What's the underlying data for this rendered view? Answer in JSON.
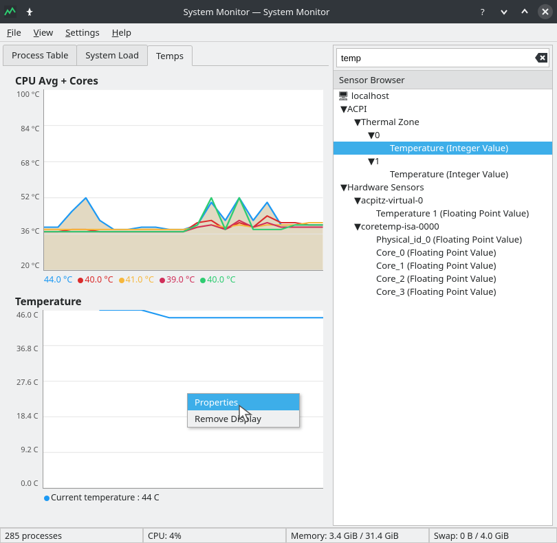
{
  "titlebar": {
    "title": "System Monitor — System Monitor"
  },
  "menubar": {
    "file": "File",
    "view": "View",
    "settings": "Settings",
    "help": "Help"
  },
  "tabs": {
    "process": "Process Table",
    "load": "System Load",
    "temps": "Temps"
  },
  "sections": {
    "cpu": "CPU Avg + Cores",
    "temperature": "Temperature"
  },
  "chart_data": [
    {
      "type": "line",
      "title": "CPU Avg + Cores",
      "ylabel": "°C",
      "ylim": [
        20,
        100
      ],
      "yticks": [
        "100 °C",
        "84 °C",
        "68 °C",
        "52 °C",
        "36 °C",
        "20 °C"
      ],
      "x": [
        0,
        5,
        10,
        15,
        20,
        25,
        30,
        35,
        40,
        45,
        50,
        55,
        60,
        65,
        70,
        75,
        80,
        85,
        90,
        95,
        100
      ],
      "series": [
        {
          "name": "CPU Avg",
          "color": "#1d99f3",
          "current_label": "44.0 °C",
          "values": [
            39,
            39,
            46,
            52,
            42,
            38,
            38,
            39,
            39,
            38,
            38,
            40,
            50,
            42,
            52,
            42,
            50,
            40,
            40,
            40,
            40
          ]
        },
        {
          "name": "Core 0",
          "color": "#da2b2b",
          "current_label": "40.0 °C",
          "values": [
            37,
            37,
            38,
            38,
            37,
            37,
            37,
            37,
            37,
            37,
            37,
            41,
            42,
            38,
            41,
            39,
            44,
            41,
            41,
            40,
            40
          ]
        },
        {
          "name": "Core 1",
          "color": "#f6b73c",
          "current_label": "41.0 °C",
          "values": [
            38,
            38,
            38,
            38,
            38,
            38,
            38,
            38,
            38,
            38,
            38,
            39,
            40,
            39,
            40,
            39,
            40,
            40,
            40,
            41,
            41
          ]
        },
        {
          "name": "Core 2",
          "color": "#d02f5a",
          "current_label": "39.0 °C",
          "values": [
            37,
            37,
            37,
            37,
            37,
            37,
            37,
            37,
            37,
            37,
            37,
            39,
            40,
            38,
            42,
            39,
            41,
            39,
            39,
            39,
            39
          ]
        },
        {
          "name": "Core 3",
          "color": "#2ecc71",
          "current_label": "40.0 °C",
          "values": [
            37,
            37,
            37,
            37,
            37,
            37,
            37,
            37,
            37,
            37,
            37,
            40,
            52,
            38,
            52,
            38,
            38,
            38,
            40,
            40,
            40
          ]
        }
      ]
    },
    {
      "type": "line",
      "title": "Temperature",
      "ylabel": "C",
      "ylim": [
        0,
        46
      ],
      "yticks": [
        "46.0 C",
        "36.8 C",
        "27.6 C",
        "18.4 C",
        "9.2 C",
        "0.0 C"
      ],
      "x": [
        0,
        5,
        10,
        15,
        20,
        25,
        30,
        35,
        40,
        45,
        50,
        55,
        60,
        65,
        70,
        75,
        80,
        85,
        90,
        95,
        100
      ],
      "series": [
        {
          "name": "Current temperature",
          "color": "#1d99f3",
          "current_label": "Current temperature : 44 C",
          "values": [
            null,
            null,
            null,
            null,
            46,
            46,
            46,
            46,
            45,
            44,
            44,
            44,
            44,
            44,
            44,
            44,
            44,
            44,
            44,
            44,
            44
          ]
        }
      ]
    }
  ],
  "search": {
    "value": "temp"
  },
  "browser": {
    "header": "Sensor Browser",
    "host": "localhost",
    "acpi": "ACPI",
    "thermal_zone": "Thermal Zone",
    "tz0": "0",
    "tz0_temp": "Temperature (Integer Value)",
    "tz1": "1",
    "tz1_temp": "Temperature (Integer Value)",
    "hw": "Hardware Sensors",
    "acpitz": "acpitz-virtual-0",
    "acpitz_t1": "Temperature 1 (Floating Point Value)",
    "coretemp": "coretemp-isa-0000",
    "phys": "Physical_id_0 (Floating Point Value)",
    "core0": "Core_0 (Floating Point Value)",
    "core1": "Core_1 (Floating Point Value)",
    "core2": "Core_2 (Floating Point Value)",
    "core3": "Core_3 (Floating Point Value)"
  },
  "context_menu": {
    "properties": "Properties",
    "remove": "Remove Display"
  },
  "status": {
    "processes": "285 processes",
    "cpu": "CPU: 4%",
    "memory": "Memory: 3.4 GiB / 31.4 GiB",
    "swap": "Swap: 0 B / 4.0 GiB"
  }
}
